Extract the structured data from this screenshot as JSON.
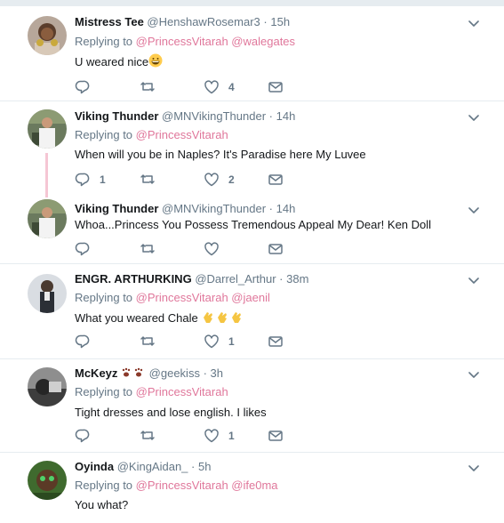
{
  "colors": {
    "mention": "#e0779b",
    "muted": "#657786",
    "divider": "#e6ecf0",
    "thread": "#f5c6d4"
  },
  "tweets": [
    {
      "name": "Mistress Tee",
      "handle": "@HenshawRosemar3",
      "time": "15h",
      "reply_prefix": "Replying to",
      "mentions": [
        "@PrincessVitarah",
        "@walegates"
      ],
      "text": "U weared nice",
      "emoji": "grinning-face-emoji",
      "likes": "4"
    },
    {
      "name": "Viking Thunder",
      "handle": "@MNVikingThunder",
      "time": "14h",
      "reply_prefix": "Replying to",
      "mentions": [
        "@PrincessVitarah"
      ],
      "text": "When will you be in Naples?  It's Paradise here My Luvee",
      "replies": "1",
      "likes": "2"
    },
    {
      "name": "Viking Thunder",
      "handle": "@MNVikingThunder",
      "time": "14h",
      "text": "Whoa...Princess You Possess Tremendous Appeal My Dear!  Ken Doll"
    },
    {
      "name": "ENGR. ARTHURKING",
      "handle": "@Darrel_Arthur",
      "time": "38m",
      "reply_prefix": "Replying to",
      "mentions": [
        "@PrincessVitarah",
        "@jaenil"
      ],
      "text": "What you weared Chale",
      "emoji": "clapping-hands-emoji",
      "likes": "1"
    },
    {
      "name": "McKeyz",
      "name_emoji": "paw-prints-emoji",
      "handle": "@geekiss",
      "time": "3h",
      "reply_prefix": "Replying to",
      "mentions": [
        "@PrincessVitarah"
      ],
      "text": "Tight dresses and lose english. I likes",
      "likes": "1"
    },
    {
      "name": "Oyinda",
      "handle": "@KingAidan_",
      "time": "5h",
      "reply_prefix": "Replying to",
      "mentions": [
        "@PrincessVitarah",
        "@ife0ma"
      ],
      "text": "You what?"
    }
  ],
  "dot": "·"
}
